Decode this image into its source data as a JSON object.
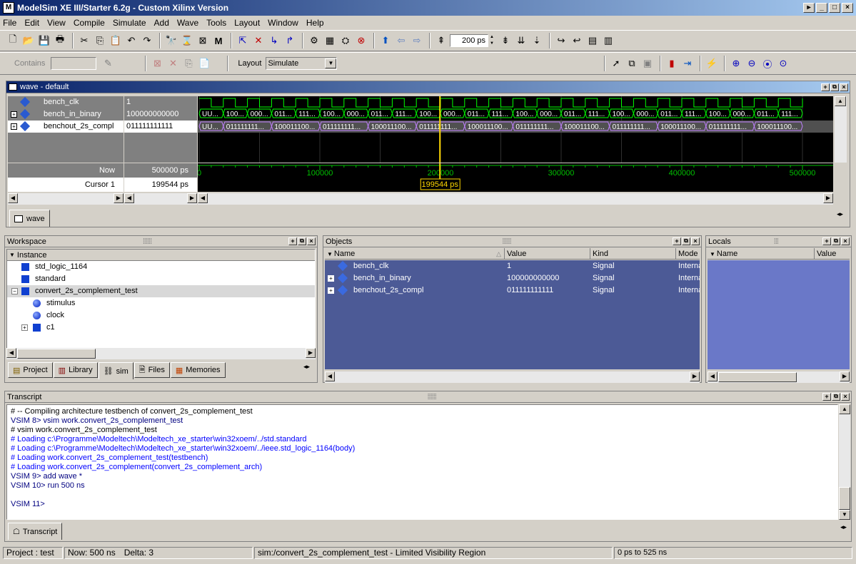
{
  "app": {
    "title": "ModelSim XE III/Starter 6.2g - Custom Xilinx Version",
    "icon": "M"
  },
  "menu": [
    "File",
    "Edit",
    "View",
    "Compile",
    "Simulate",
    "Add",
    "Wave",
    "Tools",
    "Layout",
    "Window",
    "Help"
  ],
  "toolbar": {
    "time_value": "200 ps",
    "contains_label": "Contains",
    "layout_label": "Layout",
    "layout_value": "Simulate"
  },
  "wave": {
    "title": "wave - default",
    "tab_label": "wave",
    "signals": [
      {
        "name": "bench_clk",
        "value": "1",
        "expandable": false
      },
      {
        "name": "bench_in_binary",
        "value": "100000000000",
        "expandable": true
      },
      {
        "name": "benchout_2s_compl",
        "value": "011111111111",
        "expandable": true
      }
    ],
    "now_label": "Now",
    "now_value": "500000 ps",
    "cursor_label": "Cursor 1",
    "cursor_value": "199544 ps",
    "cursor_tag": "199544 ps",
    "ticks": [
      "0",
      "100000",
      "200000",
      "300000",
      "400000",
      "500000"
    ],
    "bin_segments": [
      "UU...",
      "100...",
      "000...",
      "011...",
      "111...",
      "100...",
      "000...",
      "011...",
      "111...",
      "100...",
      "000...",
      "011...",
      "111...",
      "100...",
      "000...",
      "011...",
      "111...",
      "100...",
      "000...",
      "011...",
      "111...",
      "100...",
      "000...",
      "011...",
      "111..."
    ],
    "comp_segments": [
      "UU...",
      "011111111...",
      "100011100...",
      "011111111...",
      "100011100...",
      "011111111...",
      "100011100...",
      "011111111...",
      "100011100...",
      "011111111...",
      "100011100...",
      "011111111...",
      "100011100..."
    ]
  },
  "workspace": {
    "title": "Workspace",
    "column": "Instance",
    "items": [
      {
        "label": "std_logic_1164",
        "indent": 0,
        "kind": "square"
      },
      {
        "label": "standard",
        "indent": 0,
        "kind": "square"
      },
      {
        "label": "convert_2s_complement_test",
        "indent": 0,
        "kind": "square"
      },
      {
        "label": "stimulus",
        "indent": 1,
        "kind": "circle"
      },
      {
        "label": "clock",
        "indent": 1,
        "kind": "circle"
      },
      {
        "label": "c1",
        "indent": 1,
        "kind": "square"
      }
    ],
    "tabs": [
      "Project",
      "Library",
      "sim",
      "Files",
      "Memories"
    ]
  },
  "objects": {
    "title": "Objects",
    "columns": [
      "Name",
      "Value",
      "Kind",
      "Mode"
    ],
    "rows": [
      {
        "name": "bench_clk",
        "value": "1",
        "kind": "Signal",
        "mode": "Interna"
      },
      {
        "name": "bench_in_binary",
        "value": "100000000000",
        "kind": "Signal",
        "mode": "Interna"
      },
      {
        "name": "benchout_2s_compl",
        "value": "011111111111",
        "kind": "Signal",
        "mode": "Interna"
      }
    ]
  },
  "locals": {
    "title": "Locals",
    "columns": [
      "Name",
      "Value"
    ]
  },
  "transcript": {
    "title": "Transcript",
    "tab_label": "Transcript",
    "lines": [
      {
        "text": "# -- Compiling architecture testbench of convert_2s_complement_test",
        "color": "#000000"
      },
      {
        "text": "VSIM 8> vsim work.convert_2s_complement_test",
        "color": "#000080"
      },
      {
        "text": "# vsim work.convert_2s_complement_test",
        "color": "#000000"
      },
      {
        "text": "# Loading c:\\Programme\\Modeltech\\Modeltech_xe_starter\\win32xoem/../std.standard",
        "color": "#0000ff"
      },
      {
        "text": "# Loading c:\\Programme\\Modeltech\\Modeltech_xe_starter\\win32xoem/../ieee.std_logic_1164(body)",
        "color": "#0000ff"
      },
      {
        "text": "# Loading work.convert_2s_complement_test(testbench)",
        "color": "#0000ff"
      },
      {
        "text": "# Loading work.convert_2s_complement(convert_2s_complement_arch)",
        "color": "#0000ff"
      },
      {
        "text": "VSIM 9> add wave *",
        "color": "#000080"
      },
      {
        "text": "VSIM 10> run 500 ns",
        "color": "#000080"
      },
      {
        "text": "",
        "color": "#000000"
      },
      {
        "text": "VSIM 11>",
        "color": "#000080"
      }
    ]
  },
  "status": {
    "project": "Project : test",
    "now": "Now: 500 ns",
    "delta": "Delta: 3",
    "region": "sim:/convert_2s_complement_test - Limited Visibility Region",
    "range": "0 ps to 525 ns"
  },
  "colors": {
    "wave_bg": "#000000",
    "wave_green": "#00ff00",
    "cursor": "#ffd700",
    "selected_bg": "#4c5a96"
  }
}
